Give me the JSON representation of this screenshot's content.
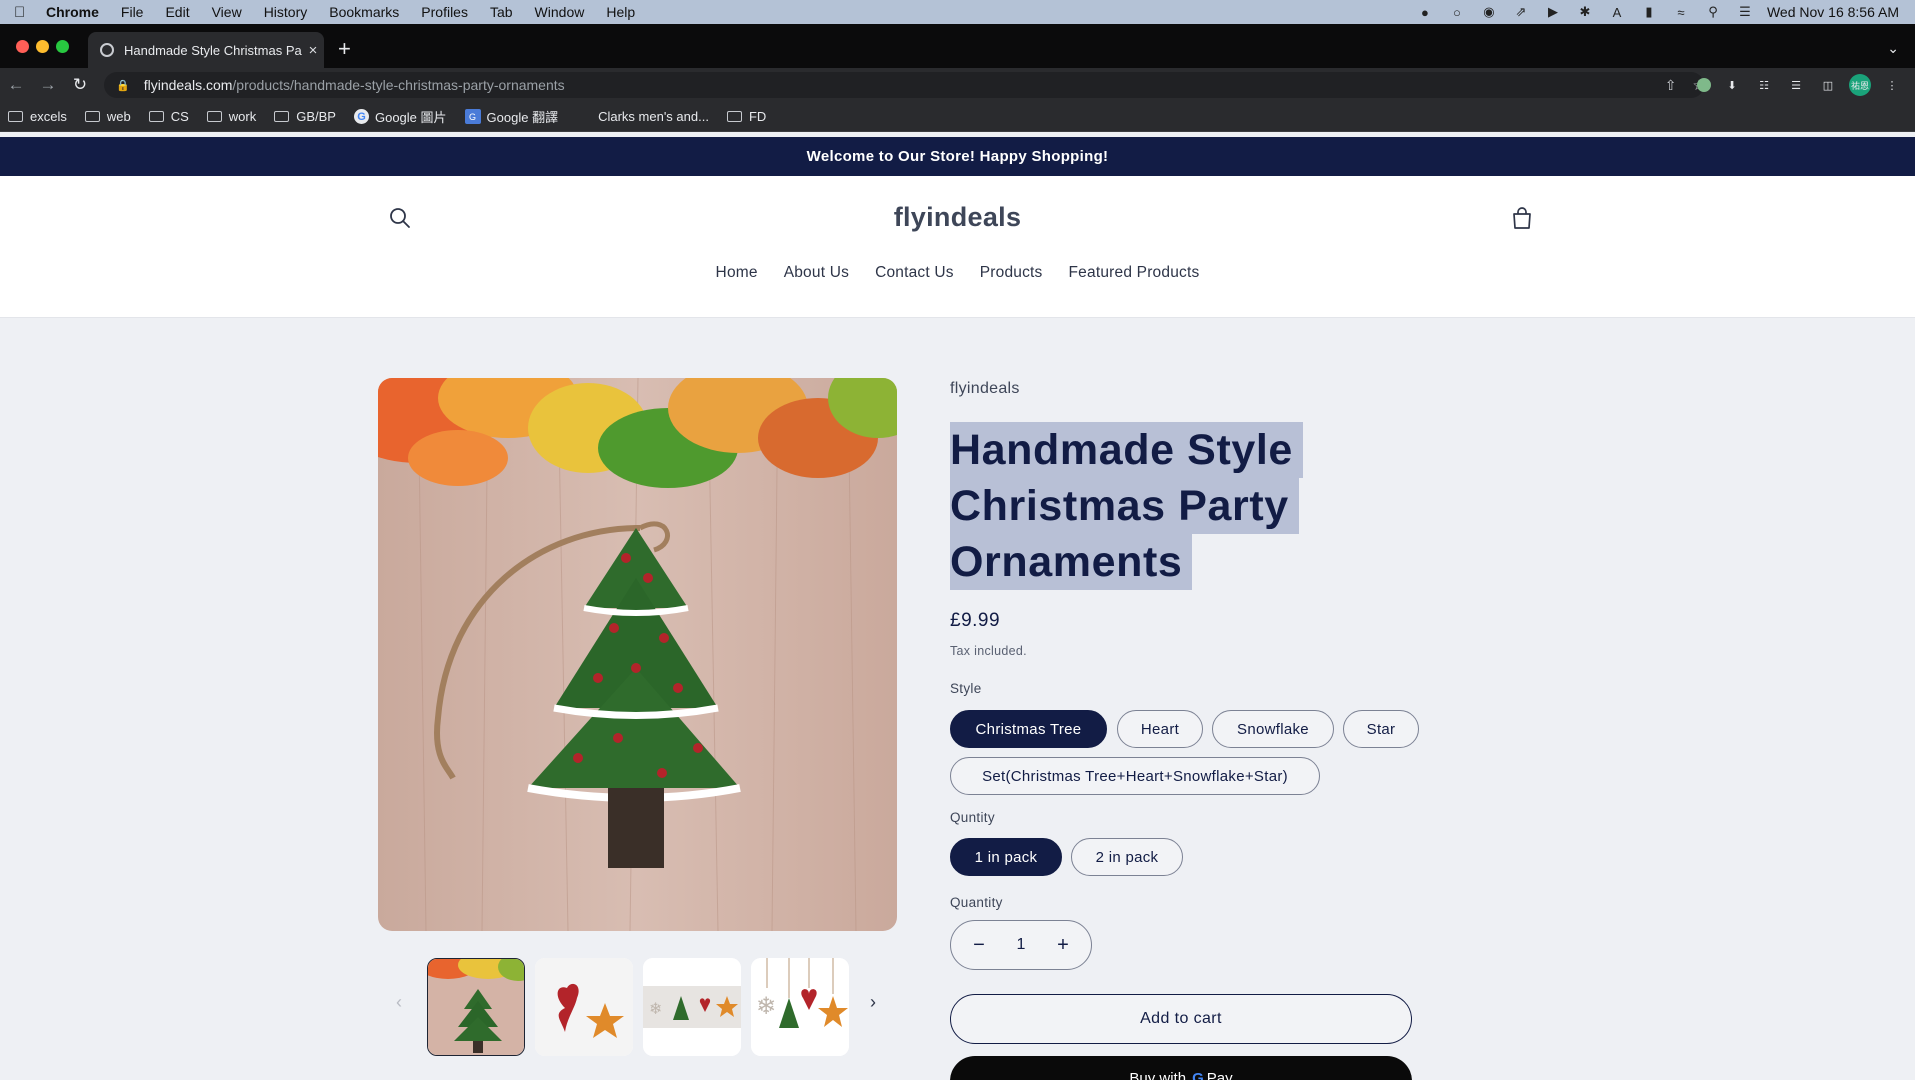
{
  "mac_menubar": {
    "app_name": "Chrome",
    "menus": [
      "File",
      "Edit",
      "View",
      "History",
      "Bookmarks",
      "Profiles",
      "Tab",
      "Window",
      "Help"
    ],
    "clock": "Wed Nov 16  8:56 AM"
  },
  "browser": {
    "tab_title": "Handmade Style Christmas Par",
    "url_host": "flyindeals.com",
    "url_path": "/products/handmade-style-christmas-party-ornaments",
    "profile_initials": "祐恩",
    "bookmarks": [
      {
        "label": "excels",
        "icon": "folder-icon"
      },
      {
        "label": "web",
        "icon": "folder-icon"
      },
      {
        "label": "CS",
        "icon": "folder-icon"
      },
      {
        "label": "work",
        "icon": "folder-icon"
      },
      {
        "label": "GB/BP",
        "icon": "folder-icon"
      },
      {
        "label": "Google 圖片",
        "icon": "google-icon"
      },
      {
        "label": "Google 翻譯",
        "icon": "translate-icon"
      },
      {
        "label": "Clarks men's and...",
        "icon": "none"
      },
      {
        "label": "FD",
        "icon": "folder-icon"
      }
    ]
  },
  "store": {
    "announcement": "Welcome to Our Store! Happy Shopping!",
    "logo": "flyindeals",
    "nav": [
      "Home",
      "About Us",
      "Contact Us",
      "Products",
      "Featured Products"
    ]
  },
  "product": {
    "vendor": "flyindeals",
    "title_lines": [
      "Handmade Style",
      "Christmas Party",
      "Ornaments"
    ],
    "price": "£9.99",
    "tax_note": "Tax included.",
    "style_label": "Style",
    "style_options": [
      "Christmas Tree",
      "Heart",
      "Snowflake",
      "Star",
      "Set(Christmas Tree+Heart+Snowflake+Star)"
    ],
    "style_selected": "Christmas Tree",
    "pack_label": "Quntity",
    "pack_options": [
      "1 in pack",
      "2 in pack"
    ],
    "pack_selected": "1 in pack",
    "quantity_label": "Quantity",
    "quantity_value": "1",
    "add_to_cart": "Add to cart",
    "buy_now_prefix": "Buy with",
    "buy_now_brand": "Pay"
  },
  "colors": {
    "announcement_bg": "#121c45",
    "accent": "#121c45",
    "title_highlight": "#b8c0d6",
    "page_bg": "#eef0f4"
  }
}
